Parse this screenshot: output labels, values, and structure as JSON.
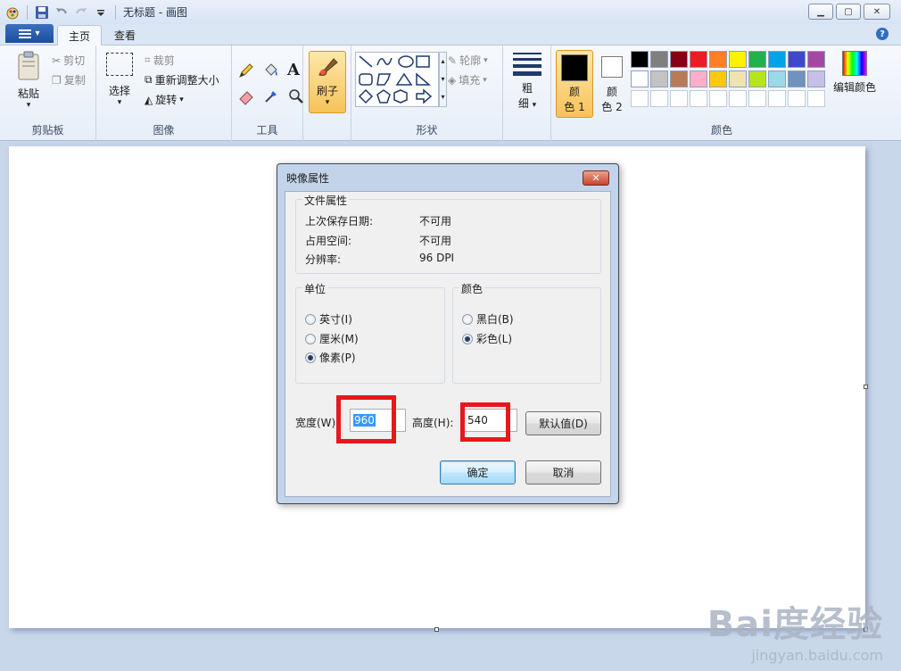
{
  "window": {
    "title": "无标题 - 画图",
    "minimize_icon": "minimize-icon",
    "maximize_icon": "maximize-icon",
    "close_icon": "close-icon"
  },
  "tabs": [
    "主页",
    "查看"
  ],
  "ribbon": {
    "clipboard": {
      "label": "剪贴板",
      "paste": "粘贴",
      "cut": "剪切",
      "copy": "复制"
    },
    "image": {
      "label": "图像",
      "select": "选择",
      "crop": "裁剪",
      "resize": "重新调整大小",
      "rotate": "旋转"
    },
    "tools": {
      "label": "工具"
    },
    "brushes": {
      "label": "刷子"
    },
    "shapes": {
      "label": "形状",
      "outline": "轮廓",
      "fill": "填充"
    },
    "size": {
      "label_line1": "粗",
      "label_line2": "细"
    },
    "colors": {
      "label": "颜色",
      "color1_line1": "颜",
      "color1_line2": "色 1",
      "color2_line1": "颜",
      "color2_line2": "色 2",
      "edit": "编辑颜色",
      "color1_value": "#000000",
      "color2_value": "#ffffff",
      "palette_row1": [
        "#000000",
        "#7f7f7f",
        "#880015",
        "#ed1c24",
        "#ff7f27",
        "#fff200",
        "#22b14c",
        "#00a2e8",
        "#3f48cc",
        "#a349a4"
      ],
      "palette_row2": [
        "#ffffff",
        "#c3c3c3",
        "#b97a57",
        "#ffaec9",
        "#ffc90e",
        "#efe4b0",
        "#b5e61d",
        "#99d9ea",
        "#7092be",
        "#c8bfe7"
      ]
    }
  },
  "dialog": {
    "title": "映像属性",
    "file_props": {
      "legend": "文件属性",
      "rows": [
        {
          "label": "上次保存日期:",
          "value": "不可用"
        },
        {
          "label": "占用空间:",
          "value": "不可用"
        },
        {
          "label": "分辨率:",
          "value": "96 DPI"
        }
      ]
    },
    "units": {
      "legend": "单位",
      "options": [
        "英寸(I)",
        "厘米(M)",
        "像素(P)"
      ],
      "selected": "像素(P)"
    },
    "colors": {
      "legend": "颜色",
      "options": [
        "黑白(B)",
        "彩色(L)"
      ],
      "selected": "彩色(L)"
    },
    "width_label": "宽度(W):",
    "width_value": "960",
    "height_label": "高度(H):",
    "height_value": "540",
    "default_button": "默认值(D)",
    "ok_button": "确定",
    "cancel_button": "取消"
  },
  "watermark": {
    "logo": "Bai度经验",
    "url": "jingyan.baidu.com"
  }
}
